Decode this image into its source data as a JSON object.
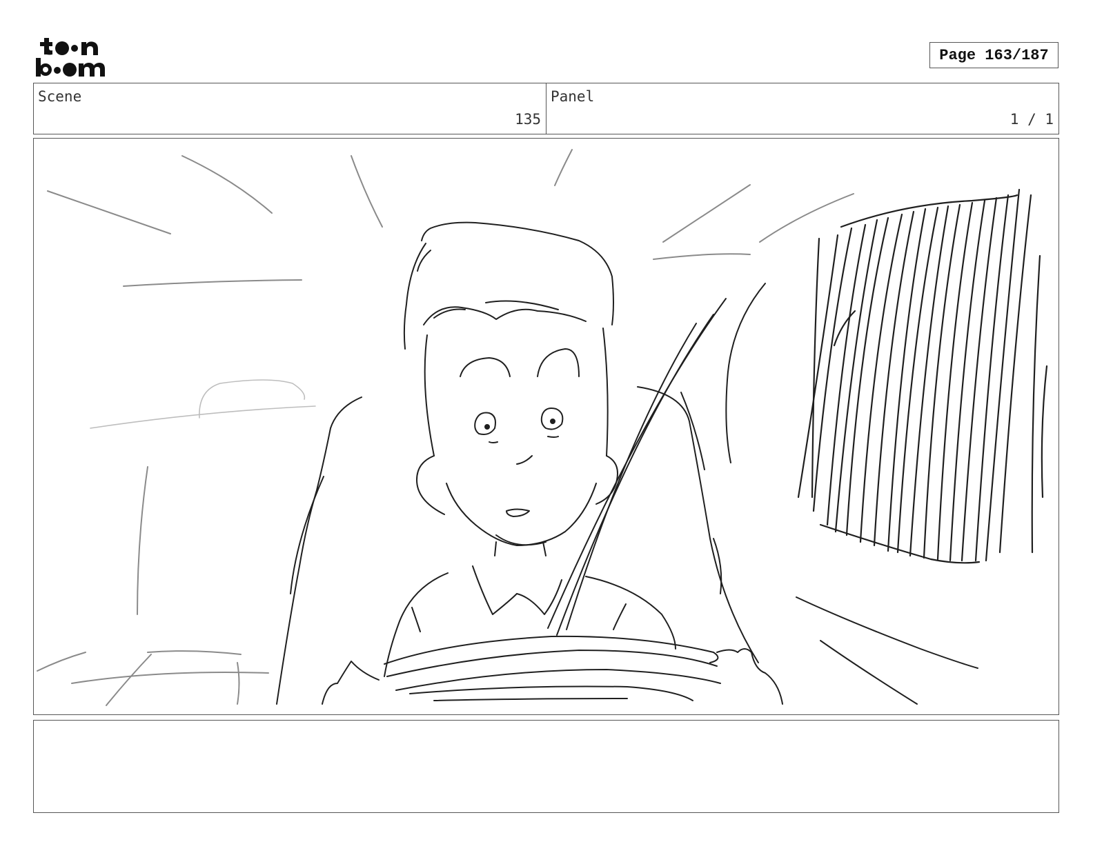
{
  "logo": {
    "line1": "toon",
    "line2": "boom"
  },
  "page_indicator": "Page 163/187",
  "scene": {
    "label": "Scene",
    "value": "135"
  },
  "panel": {
    "label": "Panel",
    "value": "1 / 1"
  },
  "sketch": {
    "subject": "boy-driving-car-sketch"
  },
  "notes": {
    "text": ""
  }
}
